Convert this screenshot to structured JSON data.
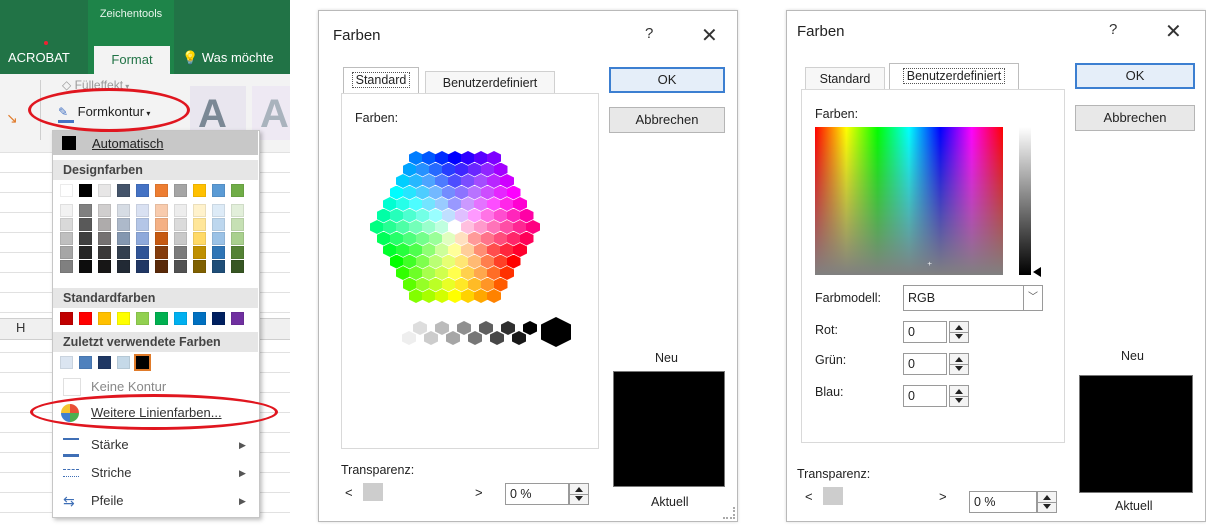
{
  "excel": {
    "context_title": "Zeichentools",
    "tabs": [
      "ACROBAT",
      "Format"
    ],
    "tell_me": "Was möchte",
    "ribbon": {
      "fill_effect": "Fülleffekt",
      "shape_outline": "Formkontur",
      "wordart_letter": "A"
    },
    "column_header": "H",
    "dropdown": {
      "automatic": "Automatisch",
      "theme_colors": "Designfarben",
      "standard_colors": "Standardfarben",
      "recent_colors": "Zuletzt verwendete Farben",
      "no_outline": "Keine Kontur",
      "more_colors": "Weitere Linienfarben...",
      "weight": "Stärke",
      "dashes": "Striche",
      "arrows": "Pfeile"
    },
    "theme_top": [
      "#ffffff",
      "#000000",
      "#e7e6e6",
      "#44546a",
      "#4472c4",
      "#ed7d31",
      "#a5a5a5",
      "#ffc000",
      "#5b9bd5",
      "#70ad47"
    ],
    "theme_columns": [
      [
        "#f2f2f2",
        "#d9d9d9",
        "#bfbfbf",
        "#a6a6a6",
        "#808080"
      ],
      [
        "#808080",
        "#595959",
        "#404040",
        "#262626",
        "#0d0d0d"
      ],
      [
        "#d0cece",
        "#aeabab",
        "#757171",
        "#3a3838",
        "#171616"
      ],
      [
        "#d6dce4",
        "#adb9ca",
        "#8497b0",
        "#333f4f",
        "#222a35"
      ],
      [
        "#d9e1f2",
        "#b4c6e7",
        "#8ea9db",
        "#305496",
        "#203764"
      ],
      [
        "#f8cbad",
        "#f4b084",
        "#c65911",
        "#843c0c",
        "#5a2a09"
      ],
      [
        "#ededed",
        "#dbdbdb",
        "#c9c9c9",
        "#7b7b7b",
        "#525252"
      ],
      [
        "#fff2cc",
        "#ffe699",
        "#ffd966",
        "#bf8f00",
        "#7f6000"
      ],
      [
        "#ddebf7",
        "#bdd7ee",
        "#9bc2e6",
        "#2f75b5",
        "#1f4e78"
      ],
      [
        "#e2efda",
        "#c6e0b4",
        "#a9d08e",
        "#548235",
        "#375623"
      ]
    ],
    "standard": [
      "#c00000",
      "#ff0000",
      "#ffc000",
      "#ffff00",
      "#92d050",
      "#00b050",
      "#00b0f0",
      "#0070c0",
      "#002060",
      "#7030a0"
    ],
    "recent": [
      "#dbe5f1",
      "#4f81bd",
      "#1f3864",
      "#c5d9e8",
      "#000000"
    ]
  },
  "dialog1": {
    "title": "Farben",
    "help": "?",
    "close": "✕",
    "tabs": [
      "Standard",
      "Benutzerdefiniert"
    ],
    "colors_label": "Farben:",
    "ok": "OK",
    "cancel": "Abbrechen",
    "new_label": "Neu",
    "current_label": "Aktuell",
    "transparency_label": "Transparenz:",
    "transparency_value": "0 %",
    "new_color": "#000000",
    "current_color": "#000000"
  },
  "dialog2": {
    "title": "Farben",
    "help": "?",
    "close": "✕",
    "tabs": [
      "Standard",
      "Benutzerdefiniert"
    ],
    "colors_label": "Farben:",
    "ok": "OK",
    "cancel": "Abbrechen",
    "color_model_label": "Farbmodell:",
    "color_model_value": "RGB",
    "red_label": "Rot:",
    "green_label": "Grün:",
    "blue_label": "Blau:",
    "red": "0",
    "green": "0",
    "blue": "0",
    "new_label": "Neu",
    "current_label": "Aktuell",
    "transparency_label": "Transparenz:",
    "transparency_value": "0 %",
    "new_color": "#000000",
    "current_color": "#000000"
  }
}
